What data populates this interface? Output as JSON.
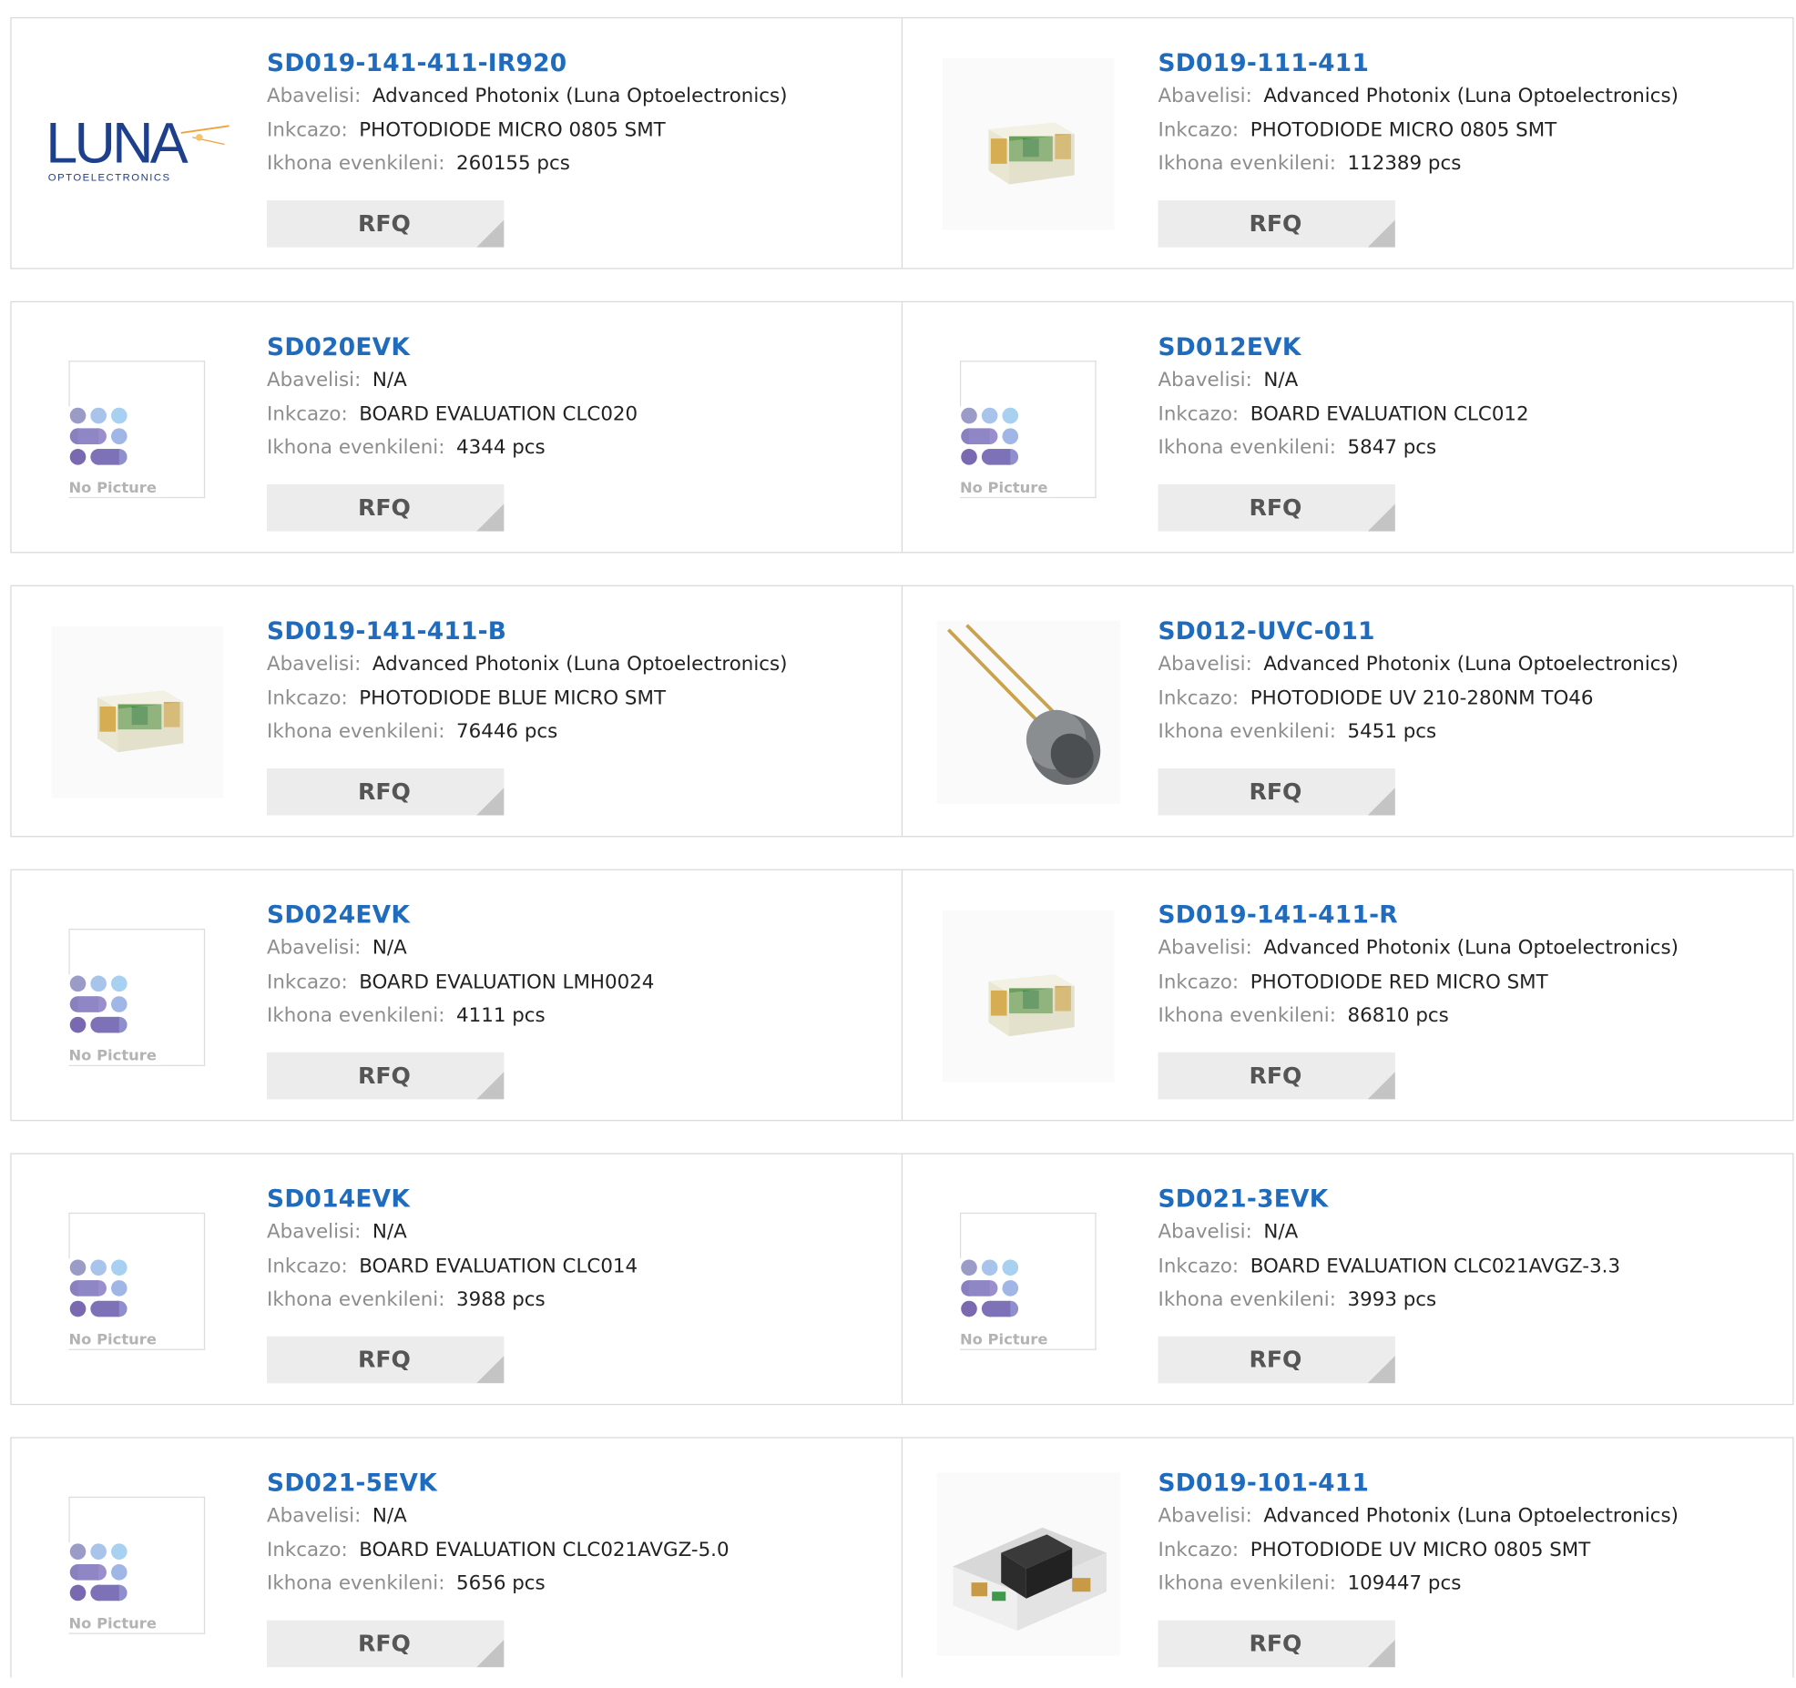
{
  "labels": {
    "manufacturer": "Abavelisi:",
    "description": "Inkcazo:",
    "stock": "Ikhona evenkileni:",
    "rfq": "RFQ",
    "no_picture": "No Picture",
    "luna_brand": "LUNA",
    "luna_sub": "OPTOELECTRONICS"
  },
  "colors": {
    "title": "#1f6bbd",
    "label": "#8d8d8d",
    "border": "#d9d9d9",
    "button_bg": "#ececec"
  },
  "products": [
    {
      "part": "SD019-141-411-IR920",
      "manufacturer": "Advanced Photonix (Luna Optoelectronics)",
      "description": "PHOTODIODE MICRO 0805 SMT",
      "stock": "260155 pcs",
      "image": "luna-logo"
    },
    {
      "part": "SD019-111-411",
      "manufacturer": "Advanced Photonix (Luna Optoelectronics)",
      "description": "PHOTODIODE MICRO 0805 SMT",
      "stock": "112389 pcs",
      "image": "smd-photodiode"
    },
    {
      "part": "SD020EVK",
      "manufacturer": "N/A",
      "description": "BOARD EVALUATION CLC020",
      "stock": "4344 pcs",
      "image": "no-picture"
    },
    {
      "part": "SD012EVK",
      "manufacturer": "N/A",
      "description": "BOARD EVALUATION CLC012",
      "stock": "5847 pcs",
      "image": "no-picture"
    },
    {
      "part": "SD019-141-411-B",
      "manufacturer": "Advanced Photonix (Luna Optoelectronics)",
      "description": "PHOTODIODE BLUE MICRO SMT",
      "stock": "76446 pcs",
      "image": "smd-photodiode"
    },
    {
      "part": "SD012-UVC-011",
      "manufacturer": "Advanced Photonix (Luna Optoelectronics)",
      "description": "PHOTODIODE UV 210-280NM TO46",
      "stock": "5451 pcs",
      "image": "to46-photodiode"
    },
    {
      "part": "SD024EVK",
      "manufacturer": "N/A",
      "description": "BOARD EVALUATION LMH0024",
      "stock": "4111 pcs",
      "image": "no-picture"
    },
    {
      "part": "SD019-141-411-R",
      "manufacturer": "Advanced Photonix (Luna Optoelectronics)",
      "description": "PHOTODIODE RED MICRO SMT",
      "stock": "86810 pcs",
      "image": "smd-photodiode"
    },
    {
      "part": "SD014EVK",
      "manufacturer": "N/A",
      "description": "BOARD EVALUATION CLC014",
      "stock": "3988 pcs",
      "image": "no-picture"
    },
    {
      "part": "SD021-3EVK",
      "manufacturer": "N/A",
      "description": "BOARD EVALUATION CLC021AVGZ-3.3",
      "stock": "3993 pcs",
      "image": "no-picture"
    },
    {
      "part": "SD021-5EVK",
      "manufacturer": "N/A",
      "description": "BOARD EVALUATION CLC021AVGZ-5.0",
      "stock": "5656 pcs",
      "image": "no-picture"
    },
    {
      "part": "SD019-101-411",
      "manufacturer": "Advanced Photonix (Luna Optoelectronics)",
      "description": "PHOTODIODE UV MICRO 0805 SMT",
      "stock": "109447 pcs",
      "image": "smd-uv-photodiode"
    }
  ]
}
